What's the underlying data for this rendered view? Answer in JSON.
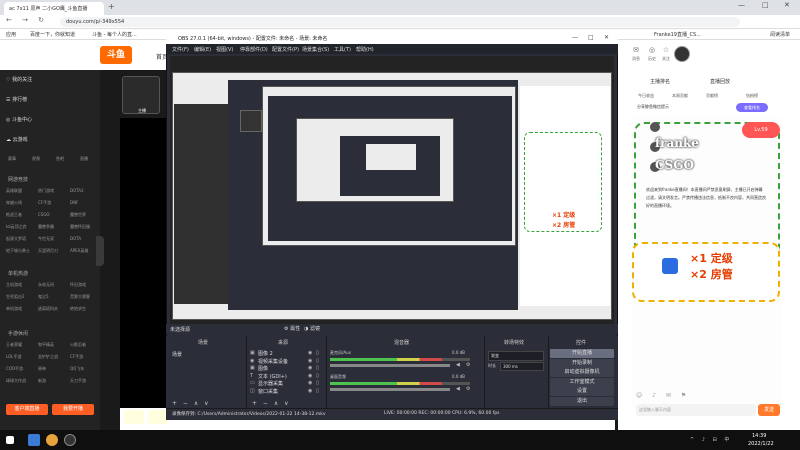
{
  "browser": {
    "tab_title": "ac 7x11 原声 二小GO鹰_斗鱼直播",
    "new_tab": "+",
    "window_controls": [
      "—",
      "□",
      "✕"
    ],
    "nav": "← → ↻",
    "url": "douyu.com/p/-349x554",
    "bookmarks": [
      "应用",
      "百度一下，你就知道",
      "斗鱼 - 每个人的直...",
      "Franke19直播_CS..."
    ],
    "reading_list": "阅读清单"
  },
  "site": {
    "logo": "斗鱼",
    "home": "首页",
    "header_icons": [
      {
        "icon": "message-icon",
        "glyph": "✉",
        "label": "消息"
      },
      {
        "icon": "location-icon",
        "glyph": "◎",
        "label": "历史"
      },
      {
        "icon": "star-icon",
        "glyph": "☆",
        "label": "关注"
      }
    ]
  },
  "sidebar": {
    "items": [
      "我的关注",
      "排行榜",
      "斗鱼中心",
      "云游戏"
    ],
    "icons_row": [
      "赛事",
      "视频",
      "鱼吧",
      "直播"
    ],
    "section_online": "网游竞技",
    "online_games": [
      [
        "英雄联盟",
        "热门游戏",
        "DOTA2"
      ],
      [
        "穿越火线",
        "CF手游",
        "DNF"
      ],
      [
        "枪战王者",
        "CSGO",
        "魔兽世界"
      ],
      [
        "lol云顶之弈",
        "魔兽争霸",
        "魔兽怀旧服"
      ],
      [
        "起源大罗塔",
        "今世无双",
        "DOTA"
      ],
      [
        "地下城与勇士",
        "天涯明月刀",
        "APEX英雄"
      ]
    ],
    "section_single": "单机热游",
    "single_games": [
      [
        "主机游戏",
        "永劫无间",
        "怀旧游戏"
      ],
      [
        "生死狙击2",
        "鬼泣5",
        "荒野大镖客"
      ],
      [
        "单机游戏",
        "逃离塔科夫",
        "绝地求生"
      ]
    ],
    "section_mobile": "手游休闲",
    "mobile_games": [
      [
        "王者荣耀",
        "和平精英",
        "火影忍者"
      ],
      [
        "LOL手游",
        "金铲铲之战",
        "CF手游"
      ],
      [
        "COD手游",
        "原神",
        "QQ飞车"
      ],
      [
        "球球大作战",
        "新游",
        "天刀手游"
      ]
    ],
    "btn_broadcast": "客户端直播",
    "btn_start": "我要开播"
  },
  "streamer": {
    "name": "主播"
  },
  "obs": {
    "title": "OBS 27.0.1 (64-bit, windows) - 配置文件: 未命名 - 场景: 未命名",
    "menus": [
      "文件(F)",
      "编辑(E)",
      "视图(V)",
      "停靠部件(D)",
      "配置文件(P)",
      "场景集合(S)",
      "工具(T)",
      "帮助(H)"
    ],
    "no_source": "未选择源",
    "props": "⚙ 属性",
    "filters": "◑ 滤镜",
    "docks": {
      "scenes_title": "场景",
      "sources_title": "来源",
      "mixer_title": "混音器",
      "transition_title": "转场特效",
      "controls_title": "控件"
    },
    "scenes": [
      "场景"
    ],
    "sources": [
      {
        "icon": "▣",
        "label": "图像 2"
      },
      {
        "icon": "◉",
        "label": "视频采集设备"
      },
      {
        "icon": "▣",
        "label": "图像"
      },
      {
        "icon": "T",
        "label": "文本 (GDI+)"
      },
      {
        "icon": "▭",
        "label": "显示器采集"
      },
      {
        "icon": "◫",
        "label": "窗口采集"
      }
    ],
    "mixer": [
      {
        "label": "麦克风/Aux",
        "db": "0.0 dB"
      },
      {
        "label": "桌面音频",
        "db": "0.0 dB"
      }
    ],
    "transition": {
      "type_label": "渐变",
      "duration_label": "时长",
      "duration": "300 ms"
    },
    "controls": [
      "开始直播",
      "开始录制",
      "启动虚拟摄像机",
      "工作室模式",
      "设置",
      "退出"
    ],
    "dock_toolbar": "+ − ∧ ∨",
    "status_path": "录像保存到: C:/Users/Administrator/Videos/2022-01-22 14-38-12.mkv",
    "status_stats": "LIVE: 00:00:00   REC: 00:00:00   CPU: 6.9%, 60.00 fps"
  },
  "nested": {
    "franke_mini": "×1 定级",
    "rooms_mini": "×2 房管"
  },
  "right_panel": {
    "tabs": [
      "主播排名",
      "直播回放"
    ],
    "subtabs": [
      "今日收益",
      "本周贡献",
      "贡献榜",
      "钻粉榜"
    ],
    "rank_btn": "查看排名",
    "wechat_tip": "分享鲸鱼微信提示",
    "franke_line1": "franke",
    "franke_line2": "CSGO",
    "pink_badge": "Lv.59",
    "notice": "欢迎来到franke直播间！本直播间严禁恶意刷屏，主播已开启弹幕过滤，请文明发言。严禁传播违法信息，抵制不良内容，共同营造良好的直播环境。",
    "card_line1": "×1 定级",
    "card_line2": "×2 房管",
    "chat_placeholder": "这里输入聊天内容",
    "send": "发送",
    "chat_tools": "☺ ♪ ✉ ⚑"
  },
  "taskbar": {
    "time": "14:39",
    "date": "2022/1/22",
    "tray": "^ ♪ ⊟ 中"
  }
}
